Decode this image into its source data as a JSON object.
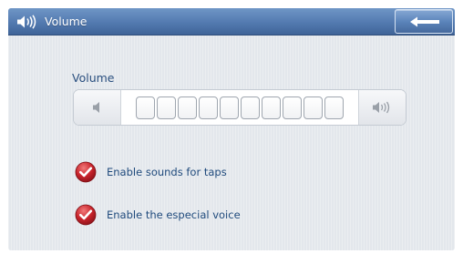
{
  "titlebar": {
    "title": "Volume",
    "icon": "speaker-icon",
    "back_icon": "back-arrow-icon"
  },
  "volume": {
    "label": "Volume",
    "down_icon": "volume-down-icon",
    "up_icon": "volume-up-icon",
    "segment_count": 10,
    "active_segments": 0
  },
  "options": [
    {
      "label": "Enable sounds for taps",
      "checked": true
    },
    {
      "label": "Enable the especial voice",
      "checked": true
    }
  ],
  "colors": {
    "titlebar": "#537ab0",
    "check_red": "#c8242c",
    "label_text": "#1f4a7c"
  }
}
